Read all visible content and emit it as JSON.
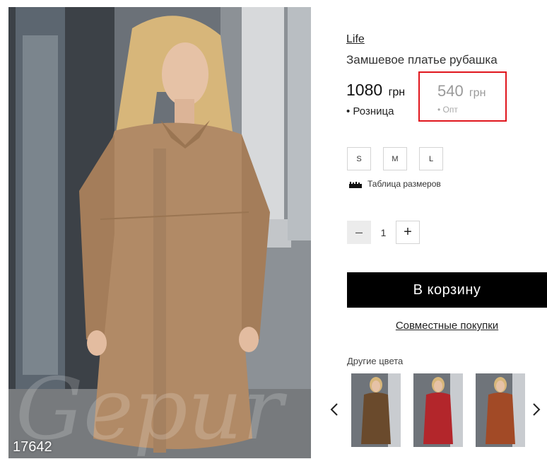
{
  "product": {
    "brand": "Life",
    "title": "Замшевое платье рубашка",
    "sku": "17642"
  },
  "price_retail": {
    "amount": "1080",
    "currency": "грн",
    "label": "• Розница"
  },
  "price_wholesale": {
    "amount": "540",
    "currency": "грн",
    "label": "• Опт"
  },
  "sizes": [
    "S",
    "M",
    "L"
  ],
  "size_table_label": "Таблица размеров",
  "quantity": {
    "minus": "–",
    "value": "1",
    "plus": "+"
  },
  "cart_button": "В корзину",
  "joint_purchase_link": "Совместные покупки",
  "other_colors": {
    "heading": "Другие цвета",
    "swatches": [
      "#6a4a2c",
      "#b3262b",
      "#a24a26"
    ]
  },
  "colors": {
    "highlight_border": "#e0161d",
    "cart_bg": "#000000",
    "dress_main": "#b18a66"
  },
  "icons": {
    "size_table": "ruler-icon",
    "prev": "chevron-left-icon",
    "next": "chevron-right-icon"
  }
}
